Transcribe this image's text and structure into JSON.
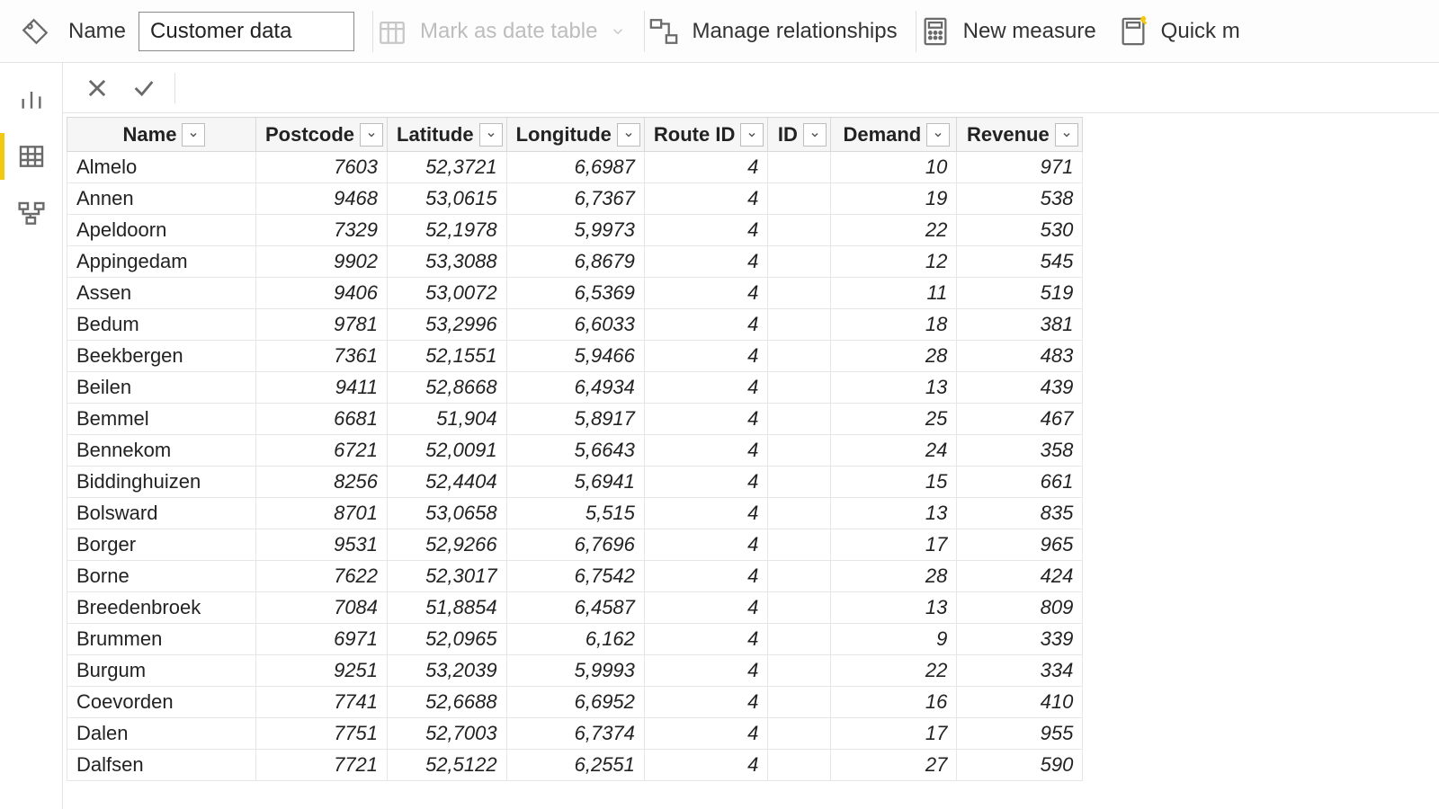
{
  "ribbon": {
    "name_label": "Name",
    "table_name_value": "Customer data",
    "mark_date_label": "Mark as date table",
    "manage_rel_label": "Manage relationships",
    "new_measure_label": "New measure",
    "quick_measure_label": "Quick m"
  },
  "formula_bar": {
    "expression": ""
  },
  "table": {
    "columns": [
      "Name",
      "Postcode",
      "Latitude",
      "Longitude",
      "Route ID",
      "ID",
      "Demand",
      "Revenue"
    ],
    "column_types": [
      "txt",
      "num",
      "num",
      "num",
      "num",
      "num",
      "num",
      "num"
    ],
    "rows": [
      [
        "Almelo",
        "7603",
        "52,3721",
        "6,6987",
        "4",
        "",
        "10",
        "971"
      ],
      [
        "Annen",
        "9468",
        "53,0615",
        "6,7367",
        "4",
        "",
        "19",
        "538"
      ],
      [
        "Apeldoorn",
        "7329",
        "52,1978",
        "5,9973",
        "4",
        "",
        "22",
        "530"
      ],
      [
        "Appingedam",
        "9902",
        "53,3088",
        "6,8679",
        "4",
        "",
        "12",
        "545"
      ],
      [
        "Assen",
        "9406",
        "53,0072",
        "6,5369",
        "4",
        "",
        "11",
        "519"
      ],
      [
        "Bedum",
        "9781",
        "53,2996",
        "6,6033",
        "4",
        "",
        "18",
        "381"
      ],
      [
        "Beekbergen",
        "7361",
        "52,1551",
        "5,9466",
        "4",
        "",
        "28",
        "483"
      ],
      [
        "Beilen",
        "9411",
        "52,8668",
        "6,4934",
        "4",
        "",
        "13",
        "439"
      ],
      [
        "Bemmel",
        "6681",
        "51,904",
        "5,8917",
        "4",
        "",
        "25",
        "467"
      ],
      [
        "Bennekom",
        "6721",
        "52,0091",
        "5,6643",
        "4",
        "",
        "24",
        "358"
      ],
      [
        "Biddinghuizen",
        "8256",
        "52,4404",
        "5,6941",
        "4",
        "",
        "15",
        "661"
      ],
      [
        "Bolsward",
        "8701",
        "53,0658",
        "5,515",
        "4",
        "",
        "13",
        "835"
      ],
      [
        "Borger",
        "9531",
        "52,9266",
        "6,7696",
        "4",
        "",
        "17",
        "965"
      ],
      [
        "Borne",
        "7622",
        "52,3017",
        "6,7542",
        "4",
        "",
        "28",
        "424"
      ],
      [
        "Breedenbroek",
        "7084",
        "51,8854",
        "6,4587",
        "4",
        "",
        "13",
        "809"
      ],
      [
        "Brummen",
        "6971",
        "52,0965",
        "6,162",
        "4",
        "",
        "9",
        "339"
      ],
      [
        "Burgum",
        "9251",
        "53,2039",
        "5,9993",
        "4",
        "",
        "22",
        "334"
      ],
      [
        "Coevorden",
        "7741",
        "52,6688",
        "6,6952",
        "4",
        "",
        "16",
        "410"
      ],
      [
        "Dalen",
        "7751",
        "52,7003",
        "6,7374",
        "4",
        "",
        "17",
        "955"
      ],
      [
        "Dalfsen",
        "7721",
        "52,5122",
        "6,2551",
        "4",
        "",
        "27",
        "590"
      ]
    ]
  }
}
